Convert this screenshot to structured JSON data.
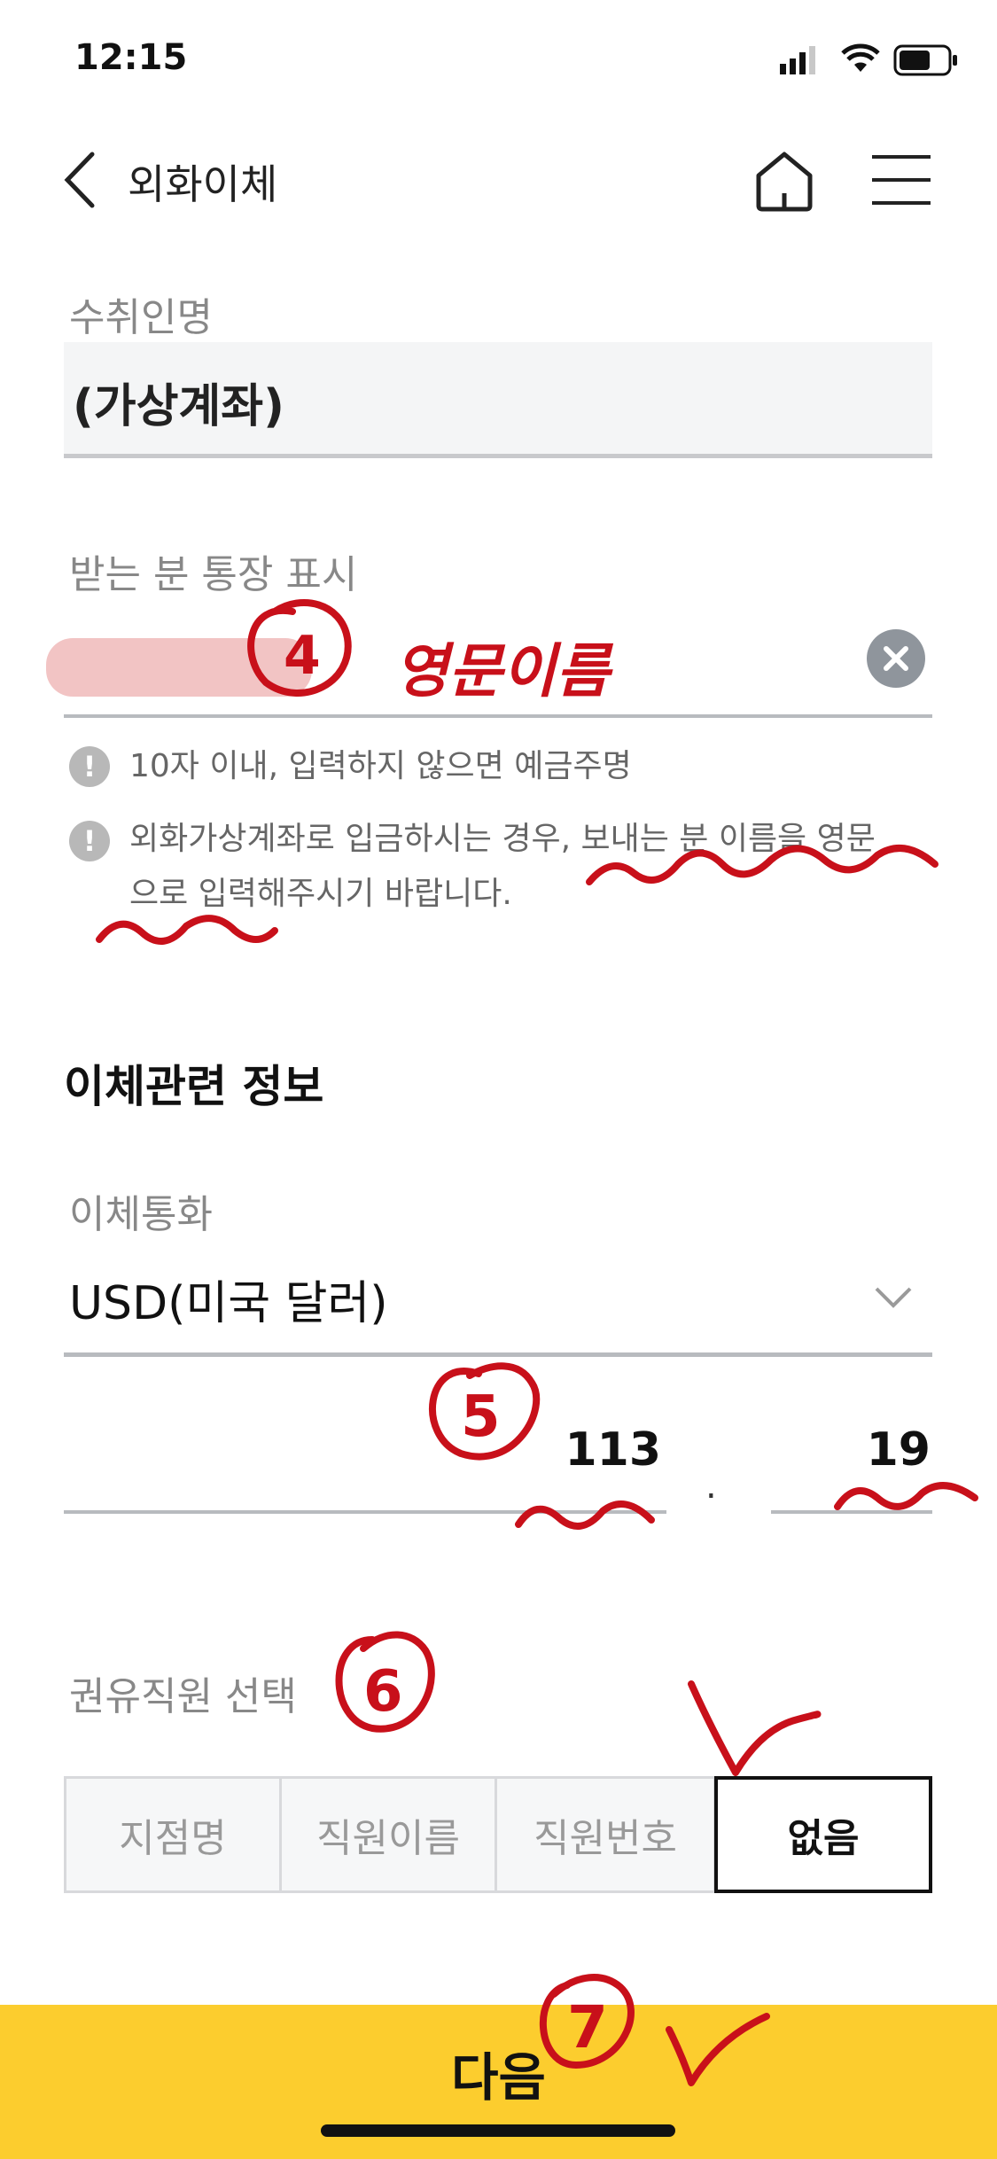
{
  "status_bar": {
    "time": "12:15"
  },
  "header": {
    "title": "외화이체"
  },
  "recipient": {
    "label": "수취인명",
    "value": "(가상계좌)"
  },
  "display_name": {
    "label": "받는 분 통장 표시",
    "value": ""
  },
  "notes": [
    {
      "text_line1": "10자 이내, 입력하지 않으면 예금주명",
      "text_line2": ""
    },
    {
      "text_line1": "외화가상계좌로 입금하시는 경우, 보내는 분 이름을 영문",
      "text_line2": "으로 입력해주시기 바랍니다."
    }
  ],
  "transfer_section": {
    "title": "이체관련 정보",
    "currency_label": "이체통화",
    "currency_value": "USD(미국 달러)",
    "amount_integer": "113",
    "amount_decimal": "19",
    "decimal_point": "."
  },
  "staff": {
    "label": "권유직원 선택",
    "options": [
      "지점명",
      "직원이름",
      "직원번호",
      "없음"
    ],
    "selected_index": 3
  },
  "next_button": {
    "label": "다음"
  },
  "annotations": {
    "circle_4": "4",
    "circle_4_text": "영문이름",
    "circle_5": "5",
    "circle_6": "6",
    "circle_7": "7",
    "ink_color": "#c8101a"
  },
  "colors": {
    "accent": "#fccd2e"
  }
}
